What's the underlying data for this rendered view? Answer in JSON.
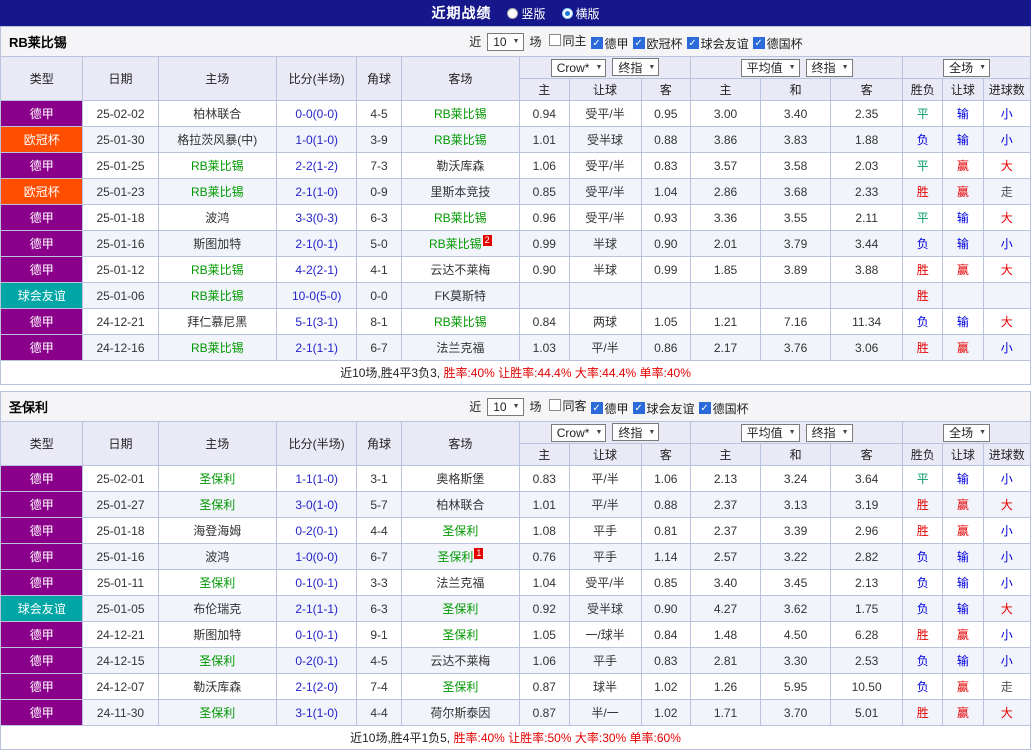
{
  "topbar": {
    "title": "近期战绩",
    "radios": [
      {
        "label": "竖版",
        "checked": false
      },
      {
        "label": "横版",
        "checked": true
      }
    ]
  },
  "league_colors": {
    "德甲": "#8B008B",
    "欧冠杯": "#FF4E00",
    "球会友谊": "#00A6A6"
  },
  "colors": {
    "topbar_bg": "#17178C",
    "highlight_team": "#009900",
    "score_text": "#2323CC",
    "win": "#E60000",
    "lose": "#0000E0",
    "draw": "#009966",
    "push": "#555555",
    "summary_rates": "#E60000",
    "grid_border": "#B9C3DD"
  },
  "sections": [
    {
      "team": "RB莱比锡",
      "filter": {
        "near_label": "近",
        "count": "10",
        "unit_label": "场",
        "checkboxes": [
          {
            "label": "同主",
            "checked": false
          },
          {
            "label": "德甲",
            "checked": true
          },
          {
            "label": "欧冠杯",
            "checked": true
          },
          {
            "label": "球会友谊",
            "checked": true
          },
          {
            "label": "德国杯",
            "checked": true
          }
        ]
      },
      "dropdowns": {
        "asia": [
          "Crow*",
          "终指"
        ],
        "euro": [
          "平均值",
          "终指"
        ],
        "scope": [
          "全场"
        ]
      },
      "headers": {
        "left": [
          "类型",
          "日期",
          "主场",
          "比分(半场)",
          "角球",
          "客场"
        ],
        "sub": [
          "主",
          "让球",
          "客",
          "主",
          "和",
          "客",
          "胜负",
          "让球",
          "进球数"
        ]
      },
      "rows": [
        {
          "league": "德甲",
          "date": "25-02-02",
          "home": {
            "text": "柏林联合",
            "hl": false
          },
          "score": "0-0(0-0)",
          "corner": "4-5",
          "away": {
            "text": "RB莱比锡",
            "hl": true
          },
          "asia": [
            "0.94",
            "受平/半",
            "0.95"
          ],
          "euro": [
            "3.00",
            "3.40",
            "2.35"
          ],
          "res": [
            [
              "平",
              "draw"
            ],
            [
              "输",
              "lose"
            ],
            [
              "小",
              "lose"
            ]
          ]
        },
        {
          "league": "欧冠杯",
          "date": "25-01-30",
          "home": {
            "text": "格拉茨风暴(中)",
            "hl": false
          },
          "score": "1-0(1-0)",
          "corner": "3-9",
          "away": {
            "text": "RB莱比锡",
            "hl": true
          },
          "asia": [
            "1.01",
            "受半球",
            "0.88"
          ],
          "euro": [
            "3.86",
            "3.83",
            "1.88"
          ],
          "res": [
            [
              "负",
              "lose"
            ],
            [
              "输",
              "lose"
            ],
            [
              "小",
              "lose"
            ]
          ]
        },
        {
          "league": "德甲",
          "date": "25-01-25",
          "home": {
            "text": "RB莱比锡",
            "hl": true
          },
          "score": "2-2(1-2)",
          "corner": "7-3",
          "away": {
            "text": "勒沃库森",
            "hl": false
          },
          "asia": [
            "1.06",
            "受平/半",
            "0.83"
          ],
          "euro": [
            "3.57",
            "3.58",
            "2.03"
          ],
          "res": [
            [
              "平",
              "draw"
            ],
            [
              "赢",
              "win"
            ],
            [
              "大",
              "win"
            ]
          ]
        },
        {
          "league": "欧冠杯",
          "date": "25-01-23",
          "home": {
            "text": "RB莱比锡",
            "hl": true
          },
          "score": "2-1(1-0)",
          "corner": "0-9",
          "away": {
            "text": "里斯本竞技",
            "hl": false
          },
          "asia": [
            "0.85",
            "受平/半",
            "1.04"
          ],
          "euro": [
            "2.86",
            "3.68",
            "2.33"
          ],
          "res": [
            [
              "胜",
              "win"
            ],
            [
              "赢",
              "win"
            ],
            [
              "走",
              "push"
            ]
          ]
        },
        {
          "league": "德甲",
          "date": "25-01-18",
          "home": {
            "text": "波鸿",
            "hl": false
          },
          "score": "3-3(0-3)",
          "corner": "6-3",
          "away": {
            "text": "RB莱比锡",
            "hl": true
          },
          "asia": [
            "0.96",
            "受平/半",
            "0.93"
          ],
          "euro": [
            "3.36",
            "3.55",
            "2.11"
          ],
          "res": [
            [
              "平",
              "draw"
            ],
            [
              "输",
              "lose"
            ],
            [
              "大",
              "win"
            ]
          ]
        },
        {
          "league": "德甲",
          "date": "25-01-16",
          "home": {
            "text": "斯图加特",
            "hl": false
          },
          "score": "2-1(0-1)",
          "corner": "5-0",
          "away": {
            "text": "RB莱比锡",
            "hl": true,
            "badge": "2"
          },
          "asia": [
            "0.99",
            "半球",
            "0.90"
          ],
          "euro": [
            "2.01",
            "3.79",
            "3.44"
          ],
          "res": [
            [
              "负",
              "lose"
            ],
            [
              "输",
              "lose"
            ],
            [
              "小",
              "lose"
            ]
          ]
        },
        {
          "league": "德甲",
          "date": "25-01-12",
          "home": {
            "text": "RB莱比锡",
            "hl": true
          },
          "score": "4-2(2-1)",
          "corner": "4-1",
          "away": {
            "text": "云达不莱梅",
            "hl": false
          },
          "asia": [
            "0.90",
            "半球",
            "0.99"
          ],
          "euro": [
            "1.85",
            "3.89",
            "3.88"
          ],
          "res": [
            [
              "胜",
              "win"
            ],
            [
              "赢",
              "win"
            ],
            [
              "大",
              "win"
            ]
          ]
        },
        {
          "league": "球会友谊",
          "date": "25-01-06",
          "home": {
            "text": "RB莱比锡",
            "hl": true
          },
          "score": "10-0(5-0)",
          "corner": "0-0",
          "away": {
            "text": "FK莫斯特",
            "hl": false
          },
          "asia": [
            "",
            "",
            ""
          ],
          "euro": [
            "",
            "",
            ""
          ],
          "res": [
            [
              "胜",
              "win"
            ],
            [
              "",
              ""
            ],
            [
              "",
              ""
            ]
          ]
        },
        {
          "league": "德甲",
          "date": "24-12-21",
          "home": {
            "text": "拜仁慕尼黑",
            "hl": false
          },
          "score": "5-1(3-1)",
          "corner": "8-1",
          "away": {
            "text": "RB莱比锡",
            "hl": true
          },
          "asia": [
            "0.84",
            "两球",
            "1.05"
          ],
          "euro": [
            "1.21",
            "7.16",
            "11.34"
          ],
          "res": [
            [
              "负",
              "lose"
            ],
            [
              "输",
              "lose"
            ],
            [
              "大",
              "win"
            ]
          ]
        },
        {
          "league": "德甲",
          "date": "24-12-16",
          "home": {
            "text": "RB莱比锡",
            "hl": true
          },
          "score": "2-1(1-1)",
          "corner": "6-7",
          "away": {
            "text": "法兰克福",
            "hl": false
          },
          "asia": [
            "1.03",
            "平/半",
            "0.86"
          ],
          "euro": [
            "2.17",
            "3.76",
            "3.06"
          ],
          "res": [
            [
              "胜",
              "win"
            ],
            [
              "赢",
              "win"
            ],
            [
              "小",
              "lose"
            ]
          ]
        }
      ],
      "summary": {
        "prefix": "近10场,胜4平3负3,",
        "rates": "胜率:40% 让胜率:44.4% 大率:44.4% 单率:40%"
      }
    },
    {
      "team": "圣保利",
      "filter": {
        "near_label": "近",
        "count": "10",
        "unit_label": "场",
        "checkboxes": [
          {
            "label": "同客",
            "checked": false
          },
          {
            "label": "德甲",
            "checked": true
          },
          {
            "label": "球会友谊",
            "checked": true
          },
          {
            "label": "德国杯",
            "checked": true
          }
        ]
      },
      "dropdowns": {
        "asia": [
          "Crow*",
          "终指"
        ],
        "euro": [
          "平均值",
          "终指"
        ],
        "scope": [
          "全场"
        ]
      },
      "headers": {
        "left": [
          "类型",
          "日期",
          "主场",
          "比分(半场)",
          "角球",
          "客场"
        ],
        "sub": [
          "主",
          "让球",
          "客",
          "主",
          "和",
          "客",
          "胜负",
          "让球",
          "进球数"
        ]
      },
      "rows": [
        {
          "league": "德甲",
          "date": "25-02-01",
          "home": {
            "text": "圣保利",
            "hl": true
          },
          "score": "1-1(1-0)",
          "corner": "3-1",
          "away": {
            "text": "奥格斯堡",
            "hl": false
          },
          "asia": [
            "0.83",
            "平/半",
            "1.06"
          ],
          "euro": [
            "2.13",
            "3.24",
            "3.64"
          ],
          "res": [
            [
              "平",
              "draw"
            ],
            [
              "输",
              "lose"
            ],
            [
              "小",
              "lose"
            ]
          ]
        },
        {
          "league": "德甲",
          "date": "25-01-27",
          "home": {
            "text": "圣保利",
            "hl": true
          },
          "score": "3-0(1-0)",
          "corner": "5-7",
          "away": {
            "text": "柏林联合",
            "hl": false
          },
          "asia": [
            "1.01",
            "平/半",
            "0.88"
          ],
          "euro": [
            "2.37",
            "3.13",
            "3.19"
          ],
          "res": [
            [
              "胜",
              "win"
            ],
            [
              "赢",
              "win"
            ],
            [
              "大",
              "win"
            ]
          ]
        },
        {
          "league": "德甲",
          "date": "25-01-18",
          "home": {
            "text": "海登海姆",
            "hl": false
          },
          "score": "0-2(0-1)",
          "corner": "4-4",
          "away": {
            "text": "圣保利",
            "hl": true
          },
          "asia": [
            "1.08",
            "平手",
            "0.81"
          ],
          "euro": [
            "2.37",
            "3.39",
            "2.96"
          ],
          "res": [
            [
              "胜",
              "win"
            ],
            [
              "赢",
              "win"
            ],
            [
              "小",
              "lose"
            ]
          ]
        },
        {
          "league": "德甲",
          "date": "25-01-16",
          "home": {
            "text": "波鸿",
            "hl": false
          },
          "score": "1-0(0-0)",
          "corner": "6-7",
          "away": {
            "text": "圣保利",
            "hl": true,
            "badge": "1"
          },
          "asia": [
            "0.76",
            "平手",
            "1.14"
          ],
          "euro": [
            "2.57",
            "3.22",
            "2.82"
          ],
          "res": [
            [
              "负",
              "lose"
            ],
            [
              "输",
              "lose"
            ],
            [
              "小",
              "lose"
            ]
          ]
        },
        {
          "league": "德甲",
          "date": "25-01-11",
          "home": {
            "text": "圣保利",
            "hl": true
          },
          "score": "0-1(0-1)",
          "corner": "3-3",
          "away": {
            "text": "法兰克福",
            "hl": false
          },
          "asia": [
            "1.04",
            "受平/半",
            "0.85"
          ],
          "euro": [
            "3.40",
            "3.45",
            "2.13"
          ],
          "res": [
            [
              "负",
              "lose"
            ],
            [
              "输",
              "lose"
            ],
            [
              "小",
              "lose"
            ]
          ]
        },
        {
          "league": "球会友谊",
          "date": "25-01-05",
          "home": {
            "text": "布伦瑞克",
            "hl": false
          },
          "score": "2-1(1-1)",
          "corner": "6-3",
          "away": {
            "text": "圣保利",
            "hl": true
          },
          "asia": [
            "0.92",
            "受半球",
            "0.90"
          ],
          "euro": [
            "4.27",
            "3.62",
            "1.75"
          ],
          "res": [
            [
              "负",
              "lose"
            ],
            [
              "输",
              "lose"
            ],
            [
              "大",
              "win"
            ]
          ]
        },
        {
          "league": "德甲",
          "date": "24-12-21",
          "home": {
            "text": "斯图加特",
            "hl": false
          },
          "score": "0-1(0-1)",
          "corner": "9-1",
          "away": {
            "text": "圣保利",
            "hl": true
          },
          "asia": [
            "1.05",
            "一/球半",
            "0.84"
          ],
          "euro": [
            "1.48",
            "4.50",
            "6.28"
          ],
          "res": [
            [
              "胜",
              "win"
            ],
            [
              "赢",
              "win"
            ],
            [
              "小",
              "lose"
            ]
          ]
        },
        {
          "league": "德甲",
          "date": "24-12-15",
          "home": {
            "text": "圣保利",
            "hl": true
          },
          "score": "0-2(0-1)",
          "corner": "4-5",
          "away": {
            "text": "云达不莱梅",
            "hl": false
          },
          "asia": [
            "1.06",
            "平手",
            "0.83"
          ],
          "euro": [
            "2.81",
            "3.30",
            "2.53"
          ],
          "res": [
            [
              "负",
              "lose"
            ],
            [
              "输",
              "lose"
            ],
            [
              "小",
              "lose"
            ]
          ]
        },
        {
          "league": "德甲",
          "date": "24-12-07",
          "home": {
            "text": "勒沃库森",
            "hl": false
          },
          "score": "2-1(2-0)",
          "corner": "7-4",
          "away": {
            "text": "圣保利",
            "hl": true
          },
          "asia": [
            "0.87",
            "球半",
            "1.02"
          ],
          "euro": [
            "1.26",
            "5.95",
            "10.50"
          ],
          "res": [
            [
              "负",
              "lose"
            ],
            [
              "赢",
              "win"
            ],
            [
              "走",
              "push"
            ]
          ]
        },
        {
          "league": "德甲",
          "date": "24-11-30",
          "home": {
            "text": "圣保利",
            "hl": true
          },
          "score": "3-1(1-0)",
          "corner": "4-4",
          "away": {
            "text": "荷尔斯泰因",
            "hl": false
          },
          "asia": [
            "0.87",
            "半/一",
            "1.02"
          ],
          "euro": [
            "1.71",
            "3.70",
            "5.01"
          ],
          "res": [
            [
              "胜",
              "win"
            ],
            [
              "赢",
              "win"
            ],
            [
              "大",
              "win"
            ]
          ]
        }
      ],
      "summary": {
        "prefix": "近10场,胜4平1负5,",
        "rates": "胜率:40% 让胜率:50% 大率:30% 单率:60%"
      }
    }
  ]
}
